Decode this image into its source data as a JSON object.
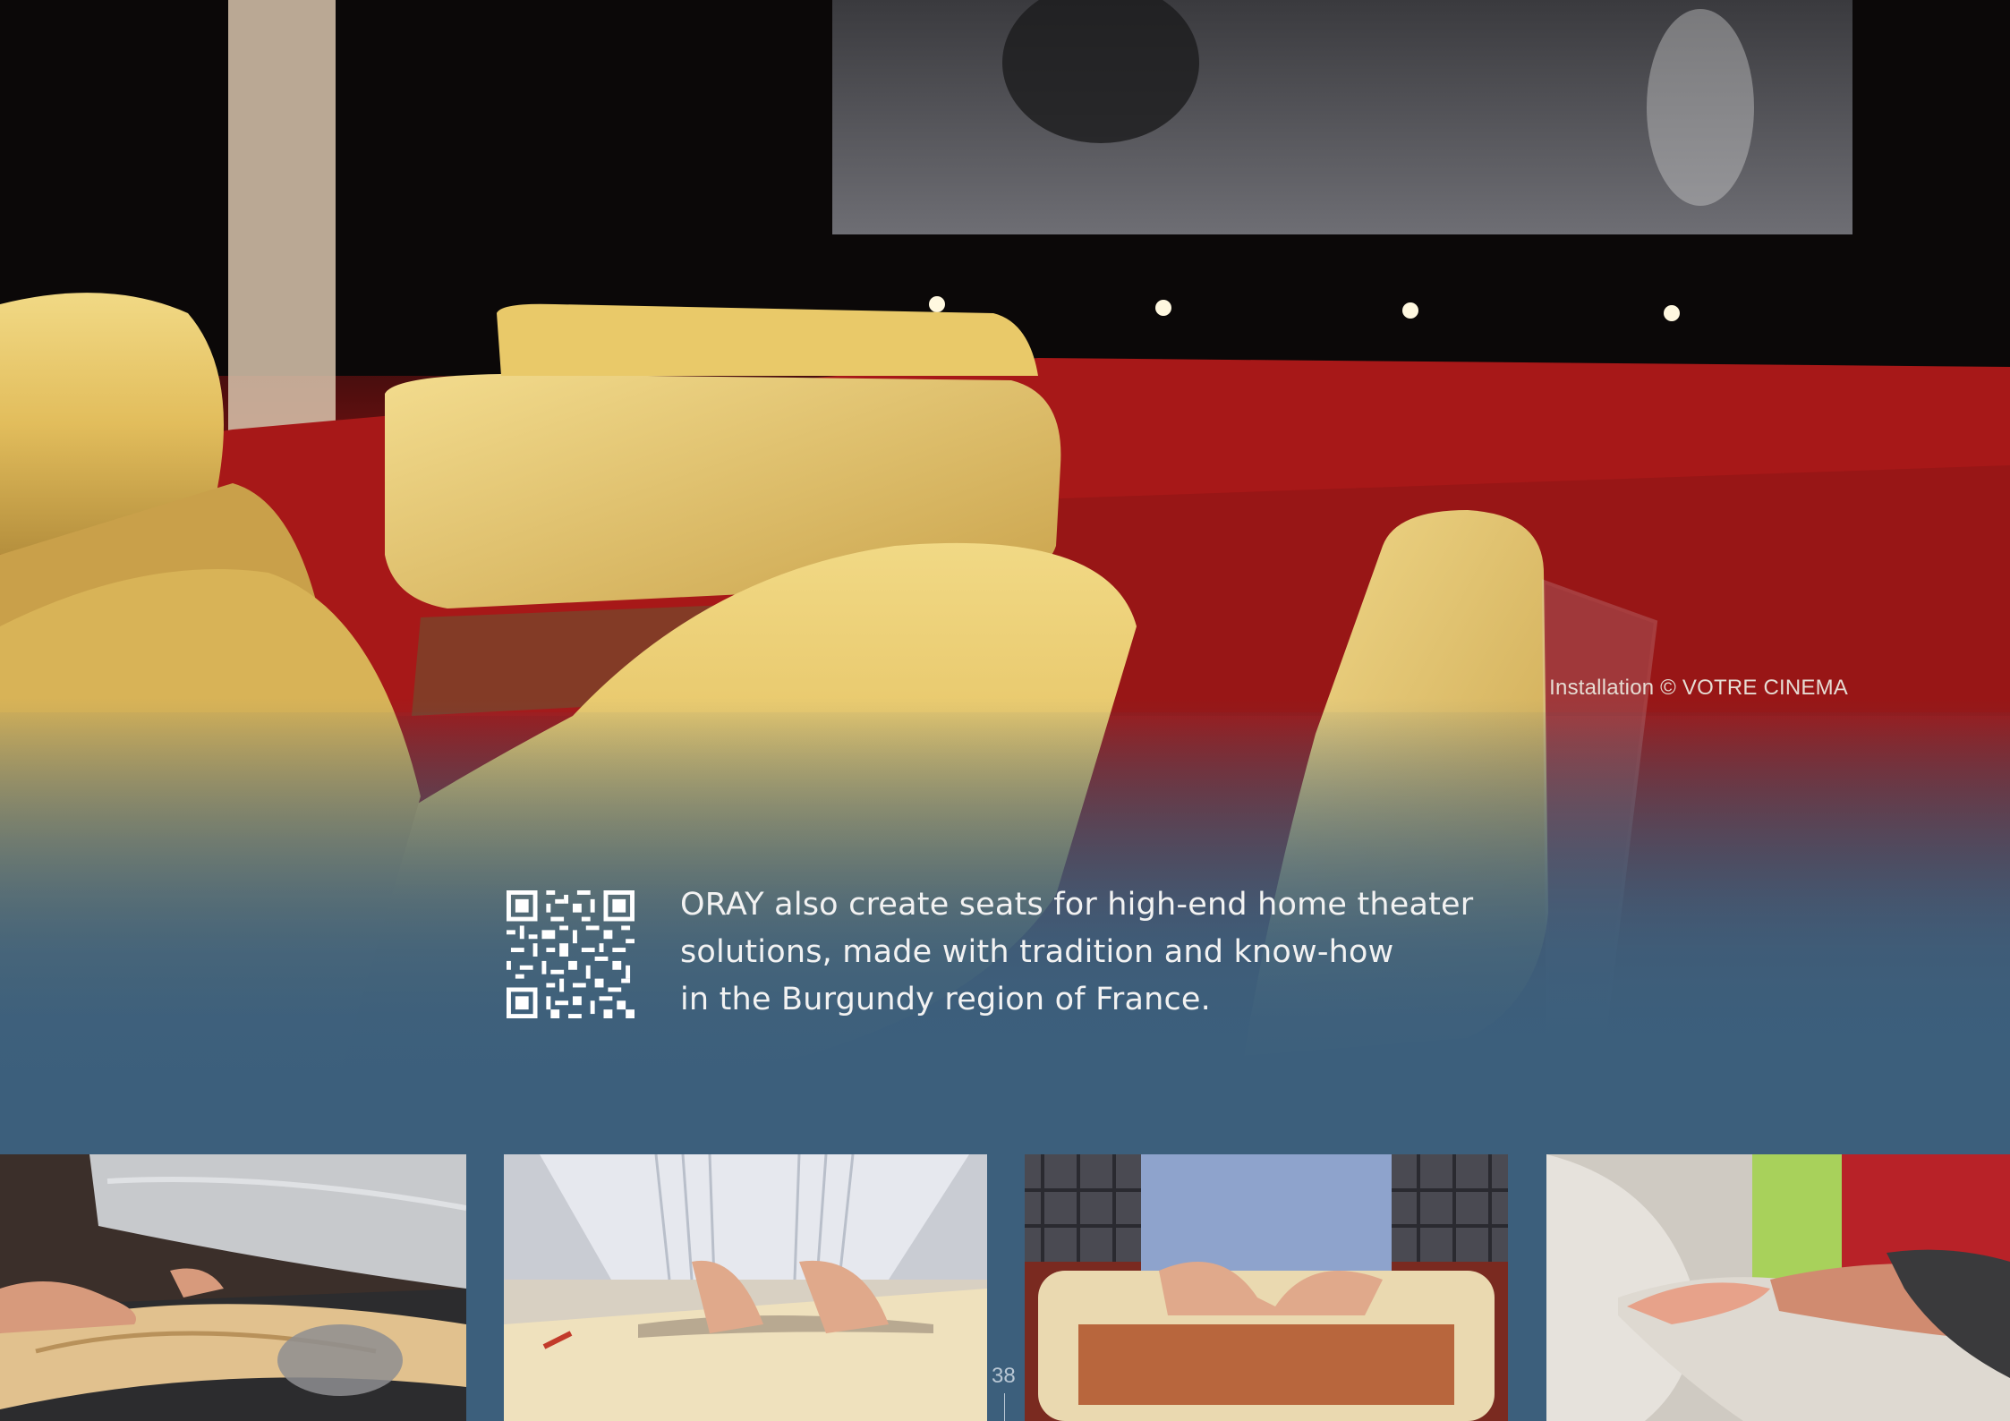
{
  "hero": {
    "credit": "Installation © VOTRE CINEMA"
  },
  "band": {
    "tagline_lines": [
      "ORAY also create seats for high-end home theater",
      "solutions, made with tradition and know-how",
      "in the Burgundy region of France."
    ]
  },
  "footer": {
    "page_number": "38"
  },
  "colors": {
    "band_blue": "#3c5f7c",
    "carpet_red": "#a51717",
    "leather_yellow": "#e8c86a"
  }
}
